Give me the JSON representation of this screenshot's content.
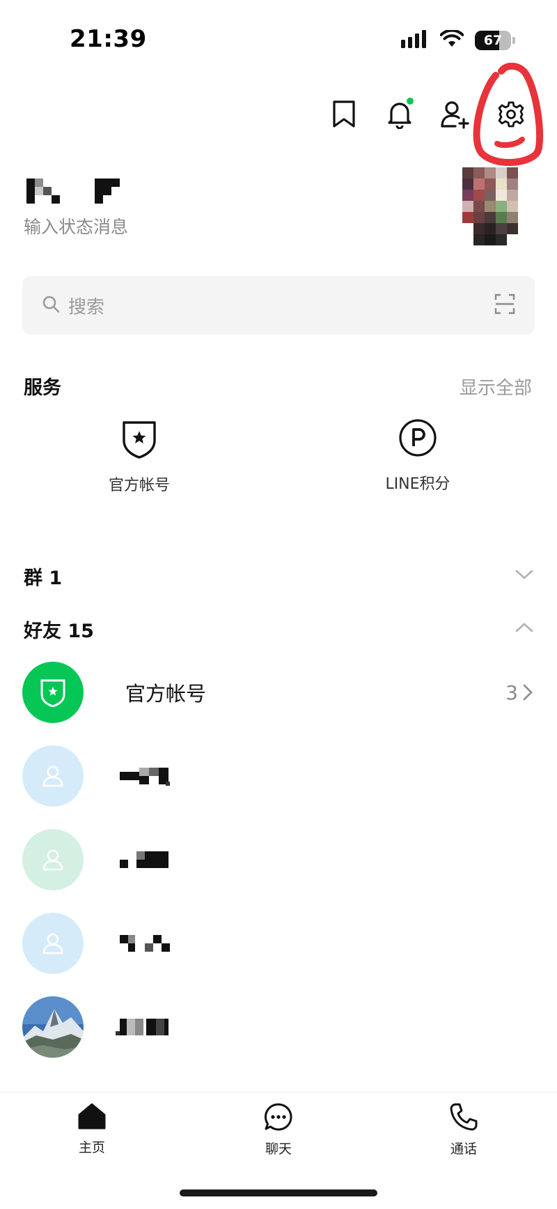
{
  "status_bar": {
    "time": "21:39",
    "battery_level": "67",
    "battery_fraction": 0.67,
    "icons": [
      "signal-icon",
      "wifi-icon",
      "battery-icon"
    ]
  },
  "header": {
    "icons": [
      "bookmark-icon",
      "bell-icon",
      "add-friend-icon",
      "settings-icon"
    ],
    "notification_dot_color": "#06c755",
    "annotation_color": "#e8333a"
  },
  "profile": {
    "status_message_placeholder": "输入状态消息"
  },
  "search": {
    "placeholder": "搜索"
  },
  "services": {
    "title": "服务",
    "show_all": "显示全部",
    "items": [
      {
        "label": "官方帐号",
        "icon": "shield-star-icon"
      },
      {
        "label": "LINE积分",
        "icon": "points-p-icon"
      }
    ]
  },
  "groups": {
    "label": "群 1",
    "state": "collapsed"
  },
  "friends": {
    "label": "好友 15",
    "state": "expanded",
    "items": [
      {
        "name": "官方帐号",
        "count": "3",
        "avatar": "official-account-avatar",
        "avatar_color": "#06c755"
      },
      {
        "name": "",
        "avatar": "default-user-avatar",
        "avatar_color": "#d6ebfa"
      },
      {
        "name": "",
        "avatar": "default-user-avatar",
        "avatar_color": "#d3f0e2"
      },
      {
        "name": "",
        "avatar": "default-user-avatar",
        "avatar_color": "#d6ebfa"
      },
      {
        "name": "",
        "avatar": "mountain-photo-avatar"
      }
    ]
  },
  "bottom_nav": {
    "items": [
      {
        "label": "主页",
        "icon": "home-icon",
        "active": true
      },
      {
        "label": "聊天",
        "icon": "chat-icon",
        "active": false
      },
      {
        "label": "通话",
        "icon": "phone-icon",
        "active": false
      }
    ]
  },
  "colors": {
    "accent": "#06c755",
    "muted_text": "#9a9a9a",
    "search_bg": "#f4f4f4"
  }
}
